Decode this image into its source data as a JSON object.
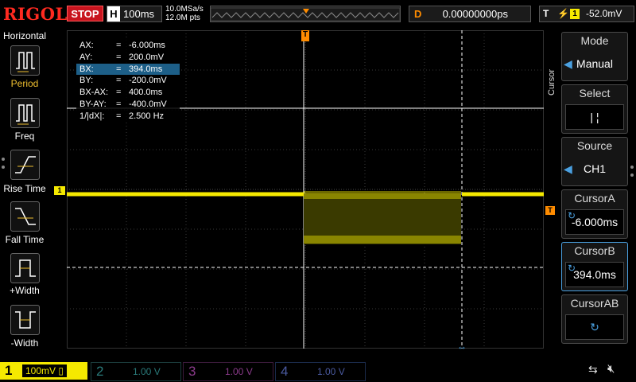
{
  "brand": "RIGOL",
  "run_status": "STOP",
  "timebase": {
    "label": "H",
    "value": "100ms"
  },
  "sample": {
    "rate": "10.0MSa/s",
    "points": "12.0M pts"
  },
  "delay": {
    "label": "D",
    "value": "0.00000000ps"
  },
  "trigger": {
    "label": "T",
    "source": "1",
    "level": "-52.0mV"
  },
  "left_menu": {
    "title": "Horizontal",
    "items": [
      {
        "label": "Period"
      },
      {
        "label": "Freq"
      },
      {
        "label": "Rise Time"
      },
      {
        "label": "Fall Time"
      },
      {
        "label": "+Width"
      },
      {
        "label": "-Width"
      }
    ]
  },
  "right_menu": {
    "side_title": "Cursor",
    "items": [
      {
        "title": "Mode",
        "value": "Manual"
      },
      {
        "title": "Select",
        "value": "|  ¦"
      },
      {
        "title": "Source",
        "value": "CH1"
      },
      {
        "title": "CursorA",
        "value": "-6.000ms"
      },
      {
        "title": "CursorB",
        "value": "394.0ms"
      },
      {
        "title": "CursorAB",
        "value": ""
      }
    ]
  },
  "cursor_readout": [
    {
      "key": "AX:",
      "value": "-6.000ms"
    },
    {
      "key": "AY:",
      "value": "200.0mV"
    },
    {
      "key": "BX:",
      "value": "394.0ms"
    },
    {
      "key": "BY:",
      "value": "-200.0mV"
    },
    {
      "key": "BX-AX:",
      "value": "400.0ms"
    },
    {
      "key": "BY-AY:",
      "value": "-400.0mV"
    },
    {
      "key": "1/|dX|:",
      "value": "2.500 Hz"
    }
  ],
  "channels": [
    {
      "num": "1",
      "scale": "100mV",
      "color": "#f5e900",
      "active": true
    },
    {
      "num": "2",
      "scale": "1.00 V",
      "color": "#00d0d0",
      "active": false
    },
    {
      "num": "3",
      "scale": "1.00 V",
      "color": "#e040e0",
      "active": false
    },
    {
      "num": "4",
      "scale": "1.00 V",
      "color": "#3c6cf0",
      "active": false
    }
  ],
  "marker_labels": {
    "channel_ref": "1",
    "trigger_pos": "T",
    "trigger_level": "T"
  },
  "colors": {
    "ch1": "#f5e900",
    "trigger": "#ff8c00",
    "stop": "#c8141e",
    "selected_row": "#1d5f88"
  }
}
